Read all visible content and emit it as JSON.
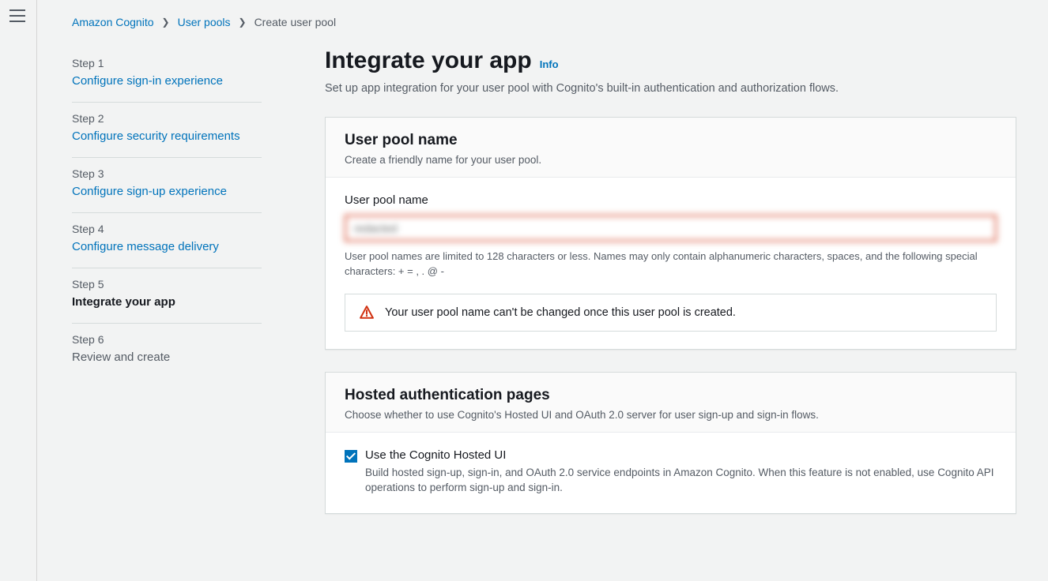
{
  "breadcrumb": {
    "service": "Amazon Cognito",
    "section": "User pools",
    "current": "Create user pool"
  },
  "steps": [
    {
      "label": "Step 1",
      "title": "Configure sign-in experience",
      "state": "link"
    },
    {
      "label": "Step 2",
      "title": "Configure security requirements",
      "state": "link"
    },
    {
      "label": "Step 3",
      "title": "Configure sign-up experience",
      "state": "link"
    },
    {
      "label": "Step 4",
      "title": "Configure message delivery",
      "state": "link"
    },
    {
      "label": "Step 5",
      "title": "Integrate your app",
      "state": "active"
    },
    {
      "label": "Step 6",
      "title": "Review and create",
      "state": "future"
    }
  ],
  "header": {
    "title": "Integrate your app",
    "info": "Info",
    "description": "Set up app integration for your user pool with Cognito's built-in authentication and authorization flows."
  },
  "panel_pool_name": {
    "title": "User pool name",
    "subtitle": "Create a friendly name for your user pool.",
    "field_label": "User pool name",
    "value": "redacted",
    "helper": "User pool names are limited to 128 characters or less. Names may only contain alphanumeric characters, spaces, and the following special characters: + = , . @ -",
    "alert": "Your user pool name can't be changed once this user pool is created."
  },
  "panel_hosted": {
    "title": "Hosted authentication pages",
    "subtitle": "Choose whether to use Cognito's Hosted UI and OAuth 2.0 server for user sign-up and sign-in flows.",
    "checkbox_label": "Use the Cognito Hosted UI",
    "checkbox_help": "Build hosted sign-up, sign-in, and OAuth 2.0 service endpoints in Amazon Cognito. When this feature is not enabled, use Cognito API operations to perform sign-up and sign-in.",
    "checked": true
  }
}
